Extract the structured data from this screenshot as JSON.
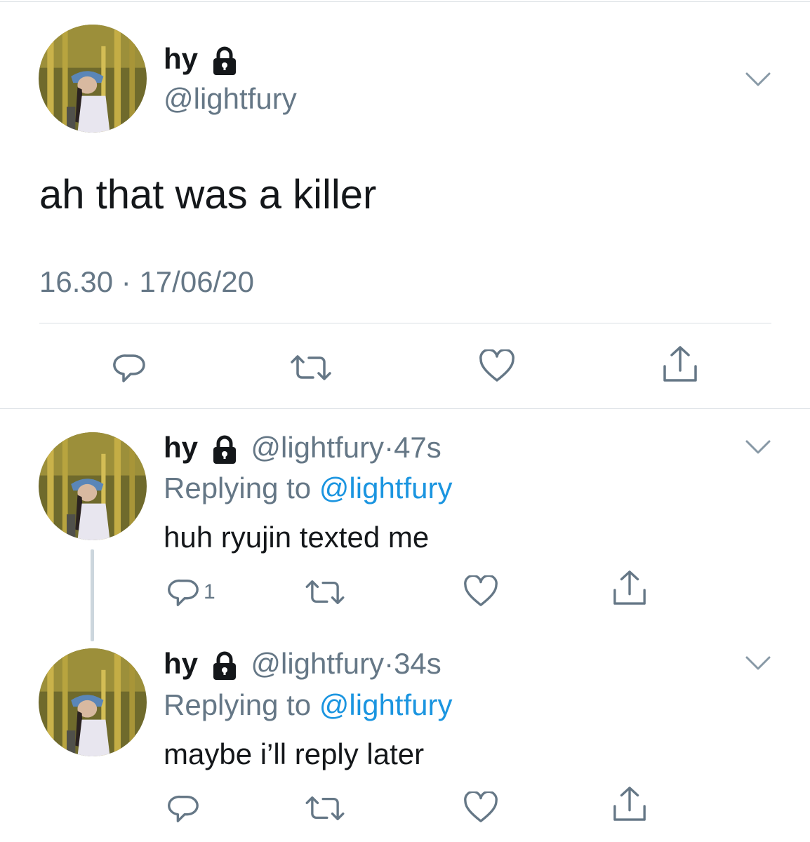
{
  "main_tweet": {
    "display_name": "hy",
    "handle": "@lightfury",
    "text": "ah that was a killer",
    "time": "16.30",
    "separator": "·",
    "date": "17/06/20"
  },
  "replies": [
    {
      "display_name": "hy",
      "handle": "@lightfury",
      "dot": "·",
      "age": "47s",
      "replying_prefix": "Replying to ",
      "replying_to": "@lightfury",
      "text": "huh ryujin texted me",
      "reply_count": "1"
    },
    {
      "display_name": "hy",
      "handle": "@lightfury",
      "dot": "·",
      "age": "34s",
      "replying_prefix": "Replying to ",
      "replying_to": "@lightfury",
      "text": "maybe i’ll reply later",
      "reply_count": ""
    }
  ],
  "icons": {
    "reply": "reply-icon",
    "retweet": "retweet-icon",
    "like": "heart-icon",
    "share": "share-icon",
    "lock": "lock-icon",
    "menu": "chevron-down-icon"
  },
  "colors": {
    "text": "#14171a",
    "secondary": "#657786",
    "link": "#1b95e0",
    "divider": "#dadfe3"
  }
}
